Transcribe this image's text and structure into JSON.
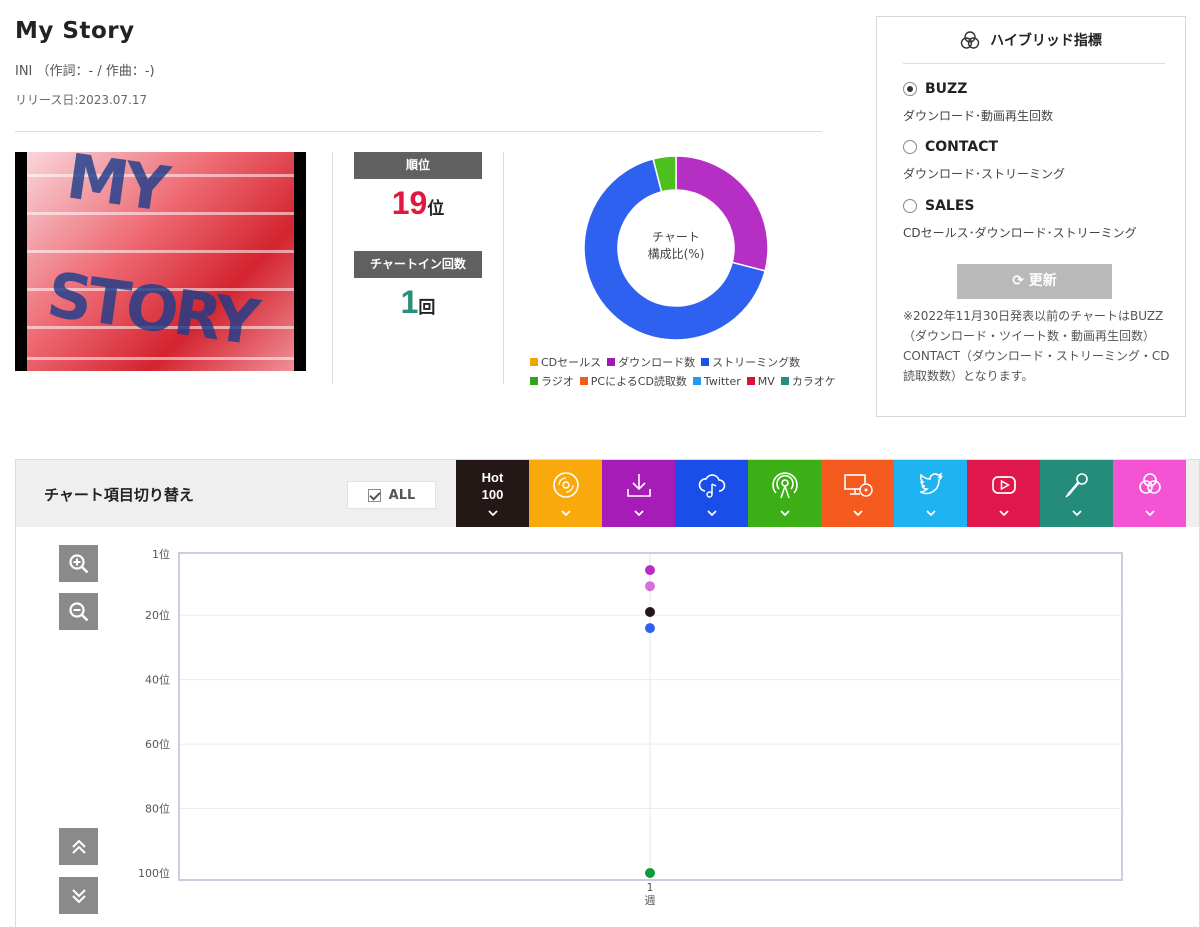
{
  "song": {
    "title": "My Story",
    "artist_line": "INI （作詞：- / 作曲：-)",
    "release": "リリース日:2023.07.17"
  },
  "thumbnail": {
    "art_text": "MY STORY"
  },
  "stats": {
    "rank_label": "順位",
    "rank_value": "19",
    "rank_unit": "位",
    "chartin_label": "チャートイン回数",
    "chartin_value": "1",
    "chartin_unit": "回"
  },
  "donut": {
    "center_line1": "チャート",
    "center_line2": "構成比(%)",
    "slices": [
      {
        "name": "ダウンロード数",
        "value": 29,
        "color": "#b62fc4"
      },
      {
        "name": "ストリーミング数",
        "value": 67,
        "color": "#2e61f0"
      },
      {
        "name": "ラジオ",
        "value": 4,
        "color": "#4cc01c"
      }
    ]
  },
  "legend": [
    {
      "label": "CDセールス",
      "color": "#f3a30a"
    },
    {
      "label": "ダウンロード数",
      "color": "#9c1ab5"
    },
    {
      "label": "ストリーミング数",
      "color": "#1a52e6"
    },
    {
      "label": "ラジオ",
      "color": "#35a21a"
    },
    {
      "label": "PCによるCD読取数",
      "color": "#f25a1a"
    },
    {
      "label": "Twitter",
      "color": "#1e9cf0"
    },
    {
      "label": "MV",
      "color": "#d4143e"
    },
    {
      "label": "カラオケ",
      "color": "#26907a"
    }
  ],
  "hybrid": {
    "heading": "ハイブリッド指標",
    "options": [
      {
        "label": "BUZZ",
        "desc": "ダウンロード･動画再生回数",
        "selected": true
      },
      {
        "label": "CONTACT",
        "desc": "ダウンロード･ストリーミング",
        "selected": false
      },
      {
        "label": "SALES",
        "desc": "CDセールス･ダウンロード･ストリーミング",
        "selected": false
      }
    ],
    "update_label": "更新",
    "note": "※2022年11月30日発表以前のチャートはBUZZ（ダウンロード・ツイート数・動画再生回数）CONTACT（ダウンロード・ストリーミング・CD読取数数）となります。"
  },
  "chart_panel": {
    "switch_label": "チャート項目切り替え",
    "all_label": "ALL",
    "tabs": [
      {
        "name": "hot100",
        "line1": "Hot",
        "line2": "100",
        "color": "#231815"
      },
      {
        "name": "cd-sales",
        "icon": "cd-icon",
        "color": "#f9a90b"
      },
      {
        "name": "download",
        "icon": "download-icon",
        "color": "#a51cb6"
      },
      {
        "name": "streaming",
        "icon": "cloud-music-icon",
        "color": "#1a4ee8"
      },
      {
        "name": "radio",
        "icon": "radio-icon",
        "color": "#3daf16"
      },
      {
        "name": "pc-cd-read",
        "icon": "pc-cd-icon",
        "color": "#f55a1f"
      },
      {
        "name": "twitter",
        "icon": "twitter-icon",
        "color": "#20b3f2"
      },
      {
        "name": "mv",
        "icon": "youtube-icon",
        "color": "#e0174a"
      },
      {
        "name": "karaoke",
        "icon": "mic-icon",
        "color": "#258c7c"
      },
      {
        "name": "hybrid",
        "icon": "hybrid-icon",
        "color": "#f454d4"
      }
    ]
  },
  "chart_data": {
    "type": "scatter",
    "x_categories": [
      "1\n週"
    ],
    "y_ticks": [
      "1位",
      "20位",
      "40位",
      "60位",
      "80位",
      "100位"
    ],
    "ylim": [
      1,
      100
    ],
    "y_inverted": true,
    "grid": true,
    "series": [
      {
        "color": "#b62fc4",
        "points": [
          [
            1,
            6
          ]
        ]
      },
      {
        "color": "#d96fd7",
        "points": [
          [
            1,
            11
          ]
        ]
      },
      {
        "color": "#231815",
        "points": [
          [
            1,
            19
          ]
        ]
      },
      {
        "color": "#2e61f0",
        "points": [
          [
            1,
            24
          ]
        ]
      },
      {
        "color": "#0b9d3a",
        "points": [
          [
            1,
            100
          ]
        ]
      }
    ]
  }
}
